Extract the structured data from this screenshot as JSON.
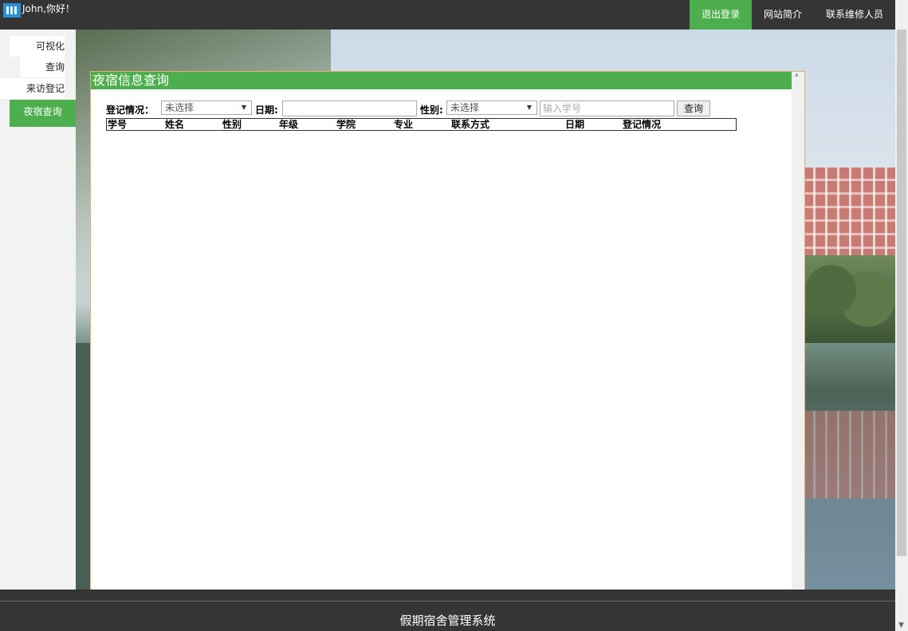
{
  "header": {
    "greeting": "John,你好！",
    "nav": [
      "退出登录",
      "网站简介",
      "联系维修人员"
    ]
  },
  "sidebar": {
    "items": [
      "可视化",
      "查询",
      "来访登记",
      "夜宿查询"
    ],
    "active": "夜宿查询"
  },
  "panel": {
    "title": "夜宿信息查询",
    "filters": {
      "status_label": "登记情况：",
      "status_value": "未选择",
      "date_label": "日期:",
      "date_value": "",
      "gender_label": "性别:",
      "gender_value": "未选择",
      "student_id_placeholder": "输入学号",
      "search_label": "查询"
    },
    "table": {
      "columns": [
        "学号",
        "姓名",
        "性别",
        "年级",
        "学院",
        "专业",
        "联系方式",
        "日期",
        "登记情况"
      ],
      "rows": []
    }
  },
  "footer": {
    "title": "假期宿舍管理系统"
  },
  "colors": {
    "accent": "#4cae4c",
    "bar": "#353535"
  }
}
